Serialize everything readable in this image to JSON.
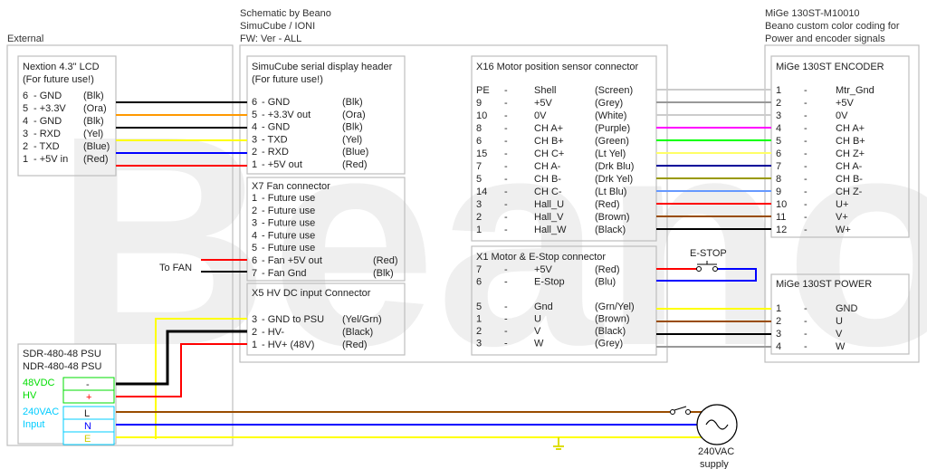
{
  "sections": {
    "external": "External",
    "schematic_lines": [
      "Schematic by Beano",
      "SimuCube / IONI",
      "FW: Ver - ALL"
    ],
    "mige_lines": [
      "MiGe 130ST-M10010",
      "Beano custom color coding for",
      "Power and encoder signals"
    ]
  },
  "nextion": {
    "title_lines": [
      "Nextion 4.3\" LCD",
      "(For future use!)"
    ],
    "rows": [
      {
        "pin": "6",
        "name": "- GND",
        "color": "(Blk)"
      },
      {
        "pin": "5",
        "name": "- +3.3V",
        "color": "(Ora)"
      },
      {
        "pin": "4",
        "name": "- GND",
        "color": "(Blk)"
      },
      {
        "pin": "3",
        "name": "- RXD",
        "color": "(Yel)"
      },
      {
        "pin": "2",
        "name": "- TXD",
        "color": "(Blue)"
      },
      {
        "pin": "1",
        "name": "- +5V in",
        "color": "(Red)"
      }
    ]
  },
  "serial_header": {
    "title_lines": [
      "SimuCube serial display header",
      "(For future use!)"
    ],
    "rows": [
      {
        "pin": "6",
        "name": "- GND",
        "color": "(Blk)"
      },
      {
        "pin": "5",
        "name": "- +3.3V out",
        "color": "(Ora)"
      },
      {
        "pin": "4",
        "name": "- GND",
        "color": "(Blk)"
      },
      {
        "pin": "3",
        "name": "- TXD",
        "color": "(Yel)"
      },
      {
        "pin": "2",
        "name": "- RXD",
        "color": "(Blue)"
      },
      {
        "pin": "1",
        "name": "- +5V out",
        "color": "(Red)"
      }
    ]
  },
  "x7": {
    "title": "X7 Fan connector",
    "rows": [
      {
        "pin": "1",
        "name": "- Future use",
        "color": ""
      },
      {
        "pin": "2",
        "name": "- Future use",
        "color": ""
      },
      {
        "pin": "3",
        "name": "- Future use",
        "color": ""
      },
      {
        "pin": "4",
        "name": "- Future use",
        "color": ""
      },
      {
        "pin": "5",
        "name": "- Future use",
        "color": ""
      },
      {
        "pin": "6",
        "name": "- Fan +5V out",
        "color": "(Red)"
      },
      {
        "pin": "7",
        "name": "- Fan Gnd",
        "color": "(Blk)"
      }
    ],
    "to_fan": "To FAN"
  },
  "x5": {
    "title": "X5 HV DC input Connector",
    "rows": [
      {
        "pin": "3",
        "name": "- GND to PSU",
        "color": "(Yel/Grn)"
      },
      {
        "pin": "2",
        "name": "- HV-",
        "color": "(Black)"
      },
      {
        "pin": "1",
        "name": "- HV+ (48V)",
        "color": "(Red)"
      }
    ]
  },
  "x16": {
    "title": "X16 Motor position sensor connector",
    "rows": [
      {
        "pin": "PE",
        "dash": "-",
        "name": "Shell",
        "color": "(Screen)"
      },
      {
        "pin": "9",
        "dash": "-",
        "name": "+5V",
        "color": "(Grey)"
      },
      {
        "pin": "10",
        "dash": "-",
        "name": "0V",
        "color": "(White)"
      },
      {
        "pin": "8",
        "dash": "-",
        "name": "CH A+",
        "color": "(Purple)"
      },
      {
        "pin": "6",
        "dash": "-",
        "name": "CH B+",
        "color": "(Green)"
      },
      {
        "pin": "15",
        "dash": "-",
        "name": "CH C+",
        "color": "(Lt Yel)"
      },
      {
        "pin": "7",
        "dash": "-",
        "name": "CH A-",
        "color": "(Drk Blu)"
      },
      {
        "pin": "5",
        "dash": "-",
        "name": "CH B-",
        "color": "(Drk Yel)"
      },
      {
        "pin": "14",
        "dash": "-",
        "name": "CH C-",
        "color": "(Lt Blu)"
      },
      {
        "pin": "3",
        "dash": "-",
        "name": "Hall_U",
        "color": "(Red)"
      },
      {
        "pin": "2",
        "dash": "-",
        "name": "Hall_V",
        "color": "(Brown)"
      },
      {
        "pin": "1",
        "dash": "-",
        "name": "Hall_W",
        "color": "(Black)"
      }
    ]
  },
  "x1": {
    "title": "X1 Motor & E-Stop connector",
    "rows": [
      {
        "pin": "7",
        "dash": "-",
        "name": "+5V",
        "color": "(Red)"
      },
      {
        "pin": "6",
        "dash": "-",
        "name": "E-Stop",
        "color": "(Blu)"
      },
      {
        "pin": "5",
        "dash": "-",
        "name": "Gnd",
        "color": "(Grn/Yel)"
      },
      {
        "pin": "1",
        "dash": "-",
        "name": "U",
        "color": "(Brown)"
      },
      {
        "pin": "2",
        "dash": "-",
        "name": "V",
        "color": "(Black)"
      },
      {
        "pin": "3",
        "dash": "-",
        "name": "W",
        "color": "(Grey)"
      }
    ]
  },
  "estop": {
    "label": "E-STOP"
  },
  "encoder": {
    "title": "MiGe 130ST ENCODER",
    "rows": [
      {
        "pin": "1",
        "dash": "-",
        "name": "Mtr_Gnd"
      },
      {
        "pin": "2",
        "dash": "-",
        "name": "+5V"
      },
      {
        "pin": "3",
        "dash": "-",
        "name": "0V"
      },
      {
        "pin": "4",
        "dash": "-",
        "name": "CH A+"
      },
      {
        "pin": "5",
        "dash": "-",
        "name": "CH B+"
      },
      {
        "pin": "6",
        "dash": "-",
        "name": "CH Z+"
      },
      {
        "pin": "7",
        "dash": "-",
        "name": "CH A-"
      },
      {
        "pin": "8",
        "dash": "-",
        "name": "CH B-"
      },
      {
        "pin": "9",
        "dash": "-",
        "name": "CH Z-"
      },
      {
        "pin": "10",
        "dash": "-",
        "name": "U+"
      },
      {
        "pin": "11",
        "dash": "-",
        "name": "V+"
      },
      {
        "pin": "12",
        "dash": "-",
        "name": "W+"
      }
    ]
  },
  "power": {
    "title": "MiGe 130ST POWER",
    "rows": [
      {
        "pin": "1",
        "dash": "-",
        "name": "GND"
      },
      {
        "pin": "2",
        "dash": "-",
        "name": "U"
      },
      {
        "pin": "3",
        "dash": "-",
        "name": "V"
      },
      {
        "pin": "4",
        "dash": "-",
        "name": "W"
      }
    ]
  },
  "psu": {
    "title_lines": [
      "SDR-480-48 PSU",
      "NDR-480-48 PSU"
    ],
    "dc_labels": [
      "48VDC",
      "HV"
    ],
    "ac_labels": [
      "240VAC",
      "Input"
    ],
    "terminals": [
      "-",
      "+",
      "L",
      "N",
      "E"
    ]
  },
  "supply": {
    "lines": [
      "240VAC",
      "supply"
    ]
  },
  "colors": {
    "black": "#000000",
    "orange": "#ff9900",
    "yellow": "#ffff00",
    "blue": "#0000ff",
    "red": "#ff0000",
    "grey": "#999999",
    "light_grey": "#cccccc",
    "purple": "#ff00ff",
    "green": "#00ff00",
    "light_yellow": "#ffff66",
    "dark_blue": "#000099",
    "dark_yellow": "#999900",
    "light_blue": "#6699ff",
    "brown": "#994c00",
    "dc_text": "#00dd00",
    "ac_text": "#00ccff",
    "box_border": "#bdbdbd"
  },
  "watermark": "Beano"
}
